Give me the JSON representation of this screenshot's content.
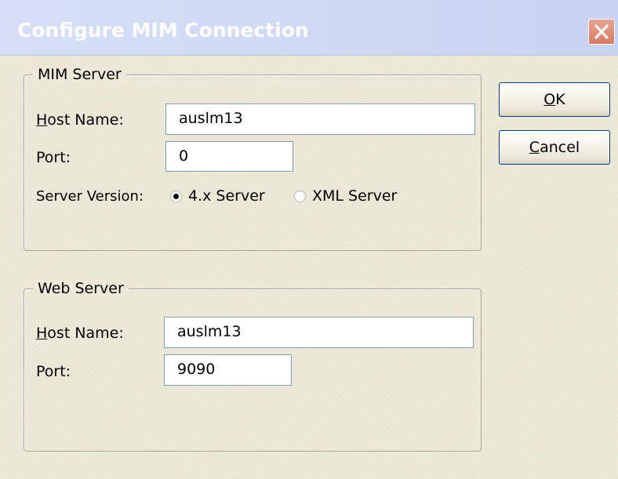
{
  "window": {
    "title": "Configure MIM Connection",
    "close_label": "×"
  },
  "mim_server": {
    "group_label": "MIM Server",
    "host_label_key": "H",
    "host_label_rest": "ost Name:",
    "host_value": "auslm13",
    "port_label": "Port:",
    "port_value": "0",
    "version_label": "Server Version:",
    "version_options": [
      {
        "label": "4.x Server",
        "selected": true
      },
      {
        "label": "XML Server",
        "selected": false
      }
    ]
  },
  "web_server": {
    "group_label": "Web Server",
    "host_label_key": "H",
    "host_label_rest": "ost Name:",
    "host_value": "auslm13",
    "port_label": "Port:",
    "port_value": "9090"
  },
  "buttons": {
    "ok_key": "O",
    "ok_rest": "K",
    "cancel_key": "C",
    "cancel_rest": "ancel"
  },
  "colors": {
    "titlebar": "#c8d3f0",
    "dialog_bg": "#ece9d8",
    "close_button": "#d97a63"
  }
}
